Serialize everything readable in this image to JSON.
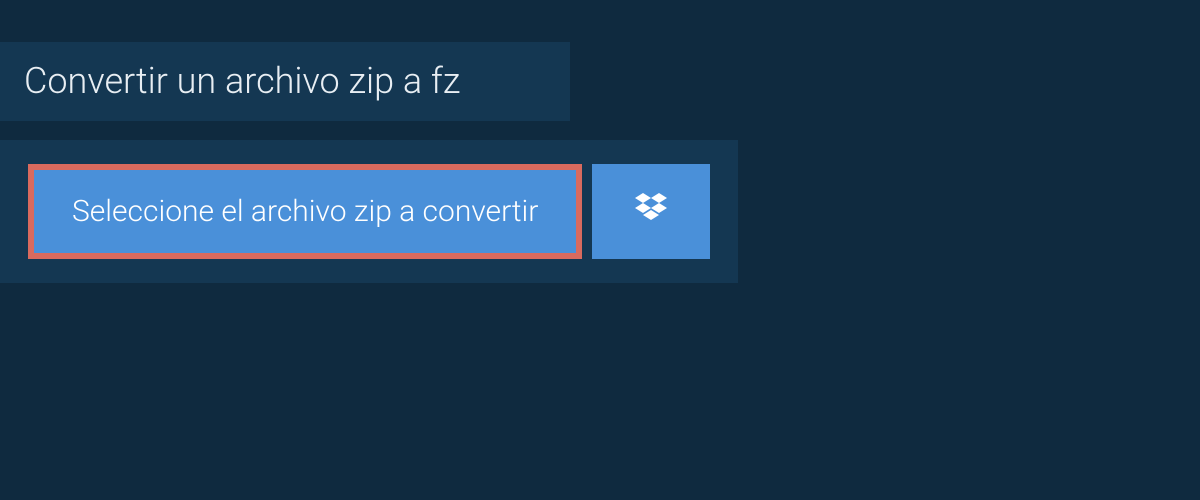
{
  "header": {
    "title": "Convertir un archivo zip a fz"
  },
  "upload": {
    "select_label": "Seleccione el archivo zip a convertir"
  }
}
